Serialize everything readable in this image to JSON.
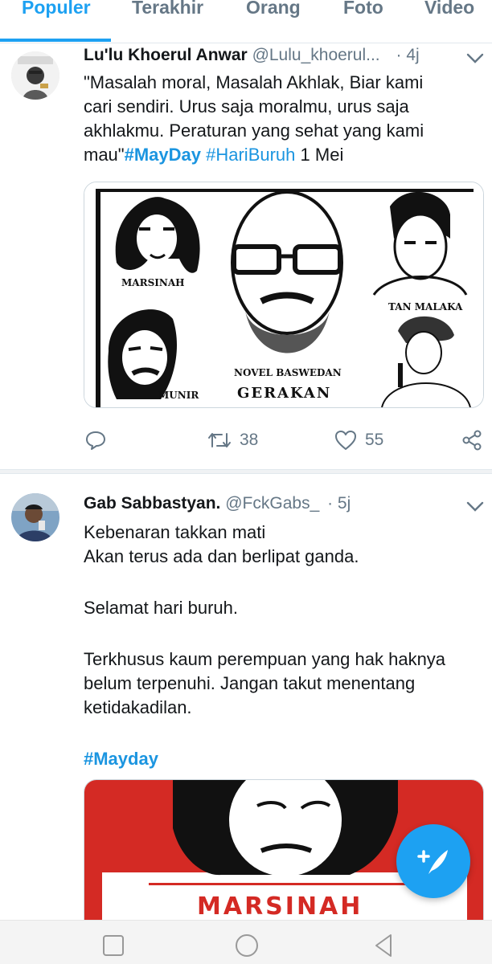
{
  "tabs": [
    {
      "label": "Populer",
      "active": true
    },
    {
      "label": "Terakhir",
      "active": false
    },
    {
      "label": "Orang",
      "active": false
    },
    {
      "label": "Foto",
      "active": false
    },
    {
      "label": "Video",
      "active": false
    }
  ],
  "tweets": [
    {
      "author": "Lu'lu Khoerul Anwar",
      "handle": "@Lulu_khoerul...",
      "time": "· 4j",
      "text_lines": [
        "\"Masalah moral, Masalah Akhlak, Biar kami",
        "cari sendiri. Urus saja moralmu, urus saja",
        "akhlakmu. Peraturan yang sehat yang kami"
      ],
      "text_last_prefix": "mau\"",
      "hashtags": [
        "#MayDay",
        "#HariBuruh"
      ],
      "text_last_suffix": "1 Mei",
      "media_labels": {
        "marsinah": "MARSINAH",
        "tan_malaka": "TAN MALAKA",
        "novel": "NOVEL BASWEDAN",
        "munir": "MUNIR",
        "gerakan": "GERAKAN"
      },
      "replies": "",
      "retweets": "38",
      "likes": "55"
    },
    {
      "author": "Gab Sabbastyan.",
      "handle": "@FckGabs_",
      "time": "· 5j",
      "text_lines": [
        "Kebenaran takkan mati",
        "Akan terus ada dan berlipat ganda.",
        "",
        "Selamat hari buruh.",
        "",
        "Terkhusus kaum perempuan yang hak haknya",
        "belum terpenuhi. Jangan takut menentang",
        "ketidakadilan."
      ],
      "hashtag": "#Mayday",
      "media_label": "MARSINAH"
    }
  ],
  "icons": {
    "reply": "reply-icon",
    "retweet": "retweet-icon",
    "like": "heart-icon",
    "share": "share-icon",
    "compose": "compose-tweet-icon"
  },
  "colors": {
    "accent": "#1da1f2",
    "hashtag": "#1b95e0",
    "muted": "#657786",
    "poster_red": "#d42a24"
  }
}
